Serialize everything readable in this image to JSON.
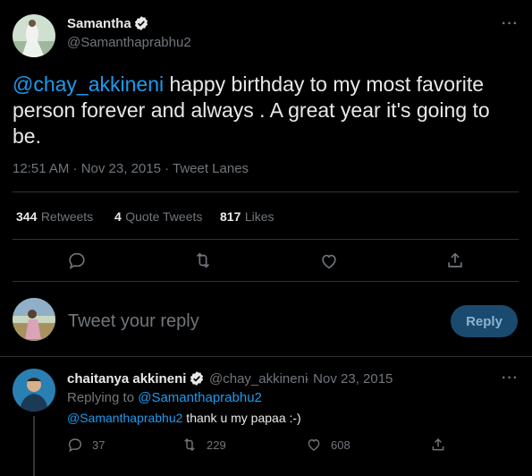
{
  "tweet": {
    "author_name": "Samantha",
    "author_handle": "@Samanthaprabhu2",
    "more_glyph": "···",
    "mention": "@chay_akkineni",
    "text_rest": " happy birthday to my most favorite person forever and always . A great year it's going to be.",
    "time": "12:51 AM · Nov 23, 2015 · Tweet Lanes",
    "retweets_count": "344",
    "retweets_label": "Retweets",
    "quotes_count": "4",
    "quotes_label": "Quote Tweets",
    "likes_count": "817",
    "likes_label": "Likes"
  },
  "composer": {
    "placeholder": "Tweet your reply",
    "button_label": "Reply"
  },
  "reply": {
    "author_name": "chaitanya akkineni",
    "author_handle": "@chay_akkineni",
    "date": "· Nov 23, 2015",
    "more_glyph": "···",
    "replying_prefix": "Replying to",
    "replying_to": "@Samanthaprabhu2",
    "body_mention": "@Samanthaprabhu2",
    "body_text": " thank u my papaa :-)",
    "reply_count": "37",
    "retweet_count": "229",
    "like_count": "608"
  },
  "colors": {
    "background": "#000000",
    "text": "#e7e9ea",
    "muted": "#71767b",
    "accent": "#1d9bf0",
    "verified": "#1d9bf0",
    "reply_button": "#1a4a6e"
  },
  "icons": [
    "verified-badge-icon",
    "more-icon",
    "reply-icon",
    "retweet-icon",
    "like-icon",
    "share-icon"
  ]
}
